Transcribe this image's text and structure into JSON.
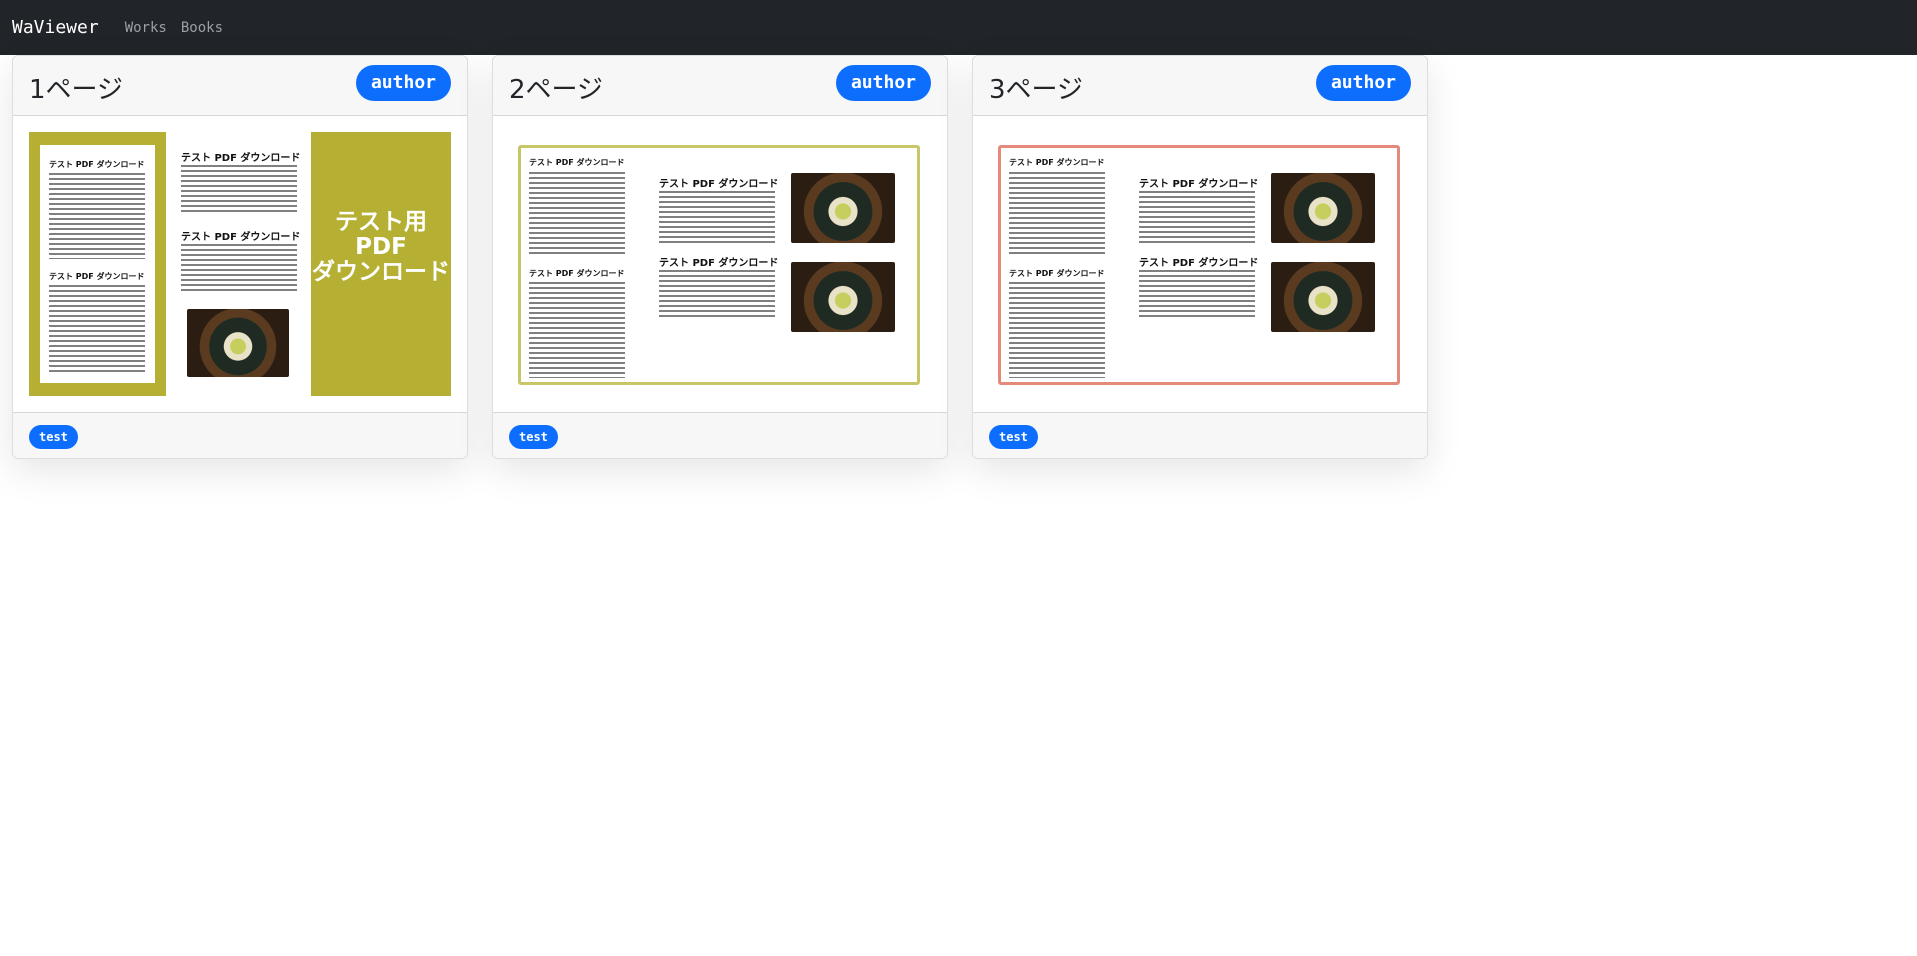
{
  "navbar": {
    "brand": "WaViewer",
    "links": [
      "Works",
      "Books"
    ]
  },
  "cards": [
    {
      "title": "1ページ",
      "author_label": "author",
      "tag": "test",
      "thumbnail": {
        "heading": "テスト PDF ダウンロード",
        "cover_lines": [
          "テスト用",
          "PDF",
          "ダウンロード"
        ],
        "cover_color": "#b5b033"
      }
    },
    {
      "title": "2ページ",
      "author_label": "author",
      "tag": "test",
      "thumbnail": {
        "heading": "テスト PDF ダウンロード",
        "frame_color": "#c9c668"
      }
    },
    {
      "title": "3ページ",
      "author_label": "author",
      "tag": "test",
      "thumbnail": {
        "heading": "テスト PDF ダウンロード",
        "frame_color": "#e58a7a"
      }
    }
  ]
}
